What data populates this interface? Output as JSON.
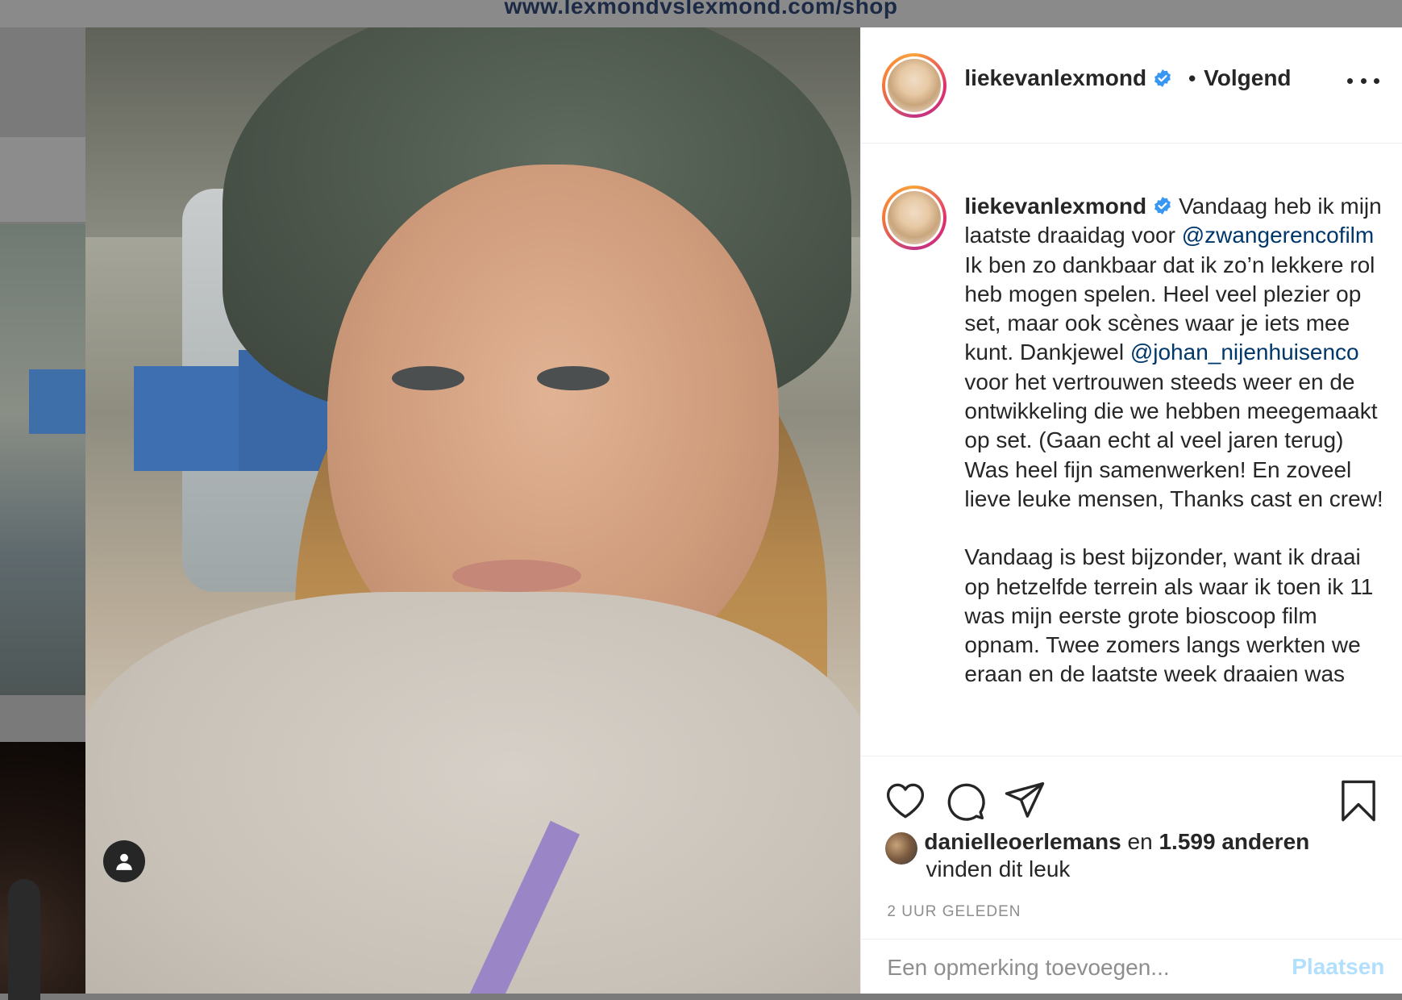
{
  "background": {
    "url_text": "www.lexmondvslexmond.com/shop"
  },
  "post": {
    "author": {
      "username": "liekevanlexmond",
      "verified": true
    },
    "header": {
      "separator": "•",
      "follow_status": "Volgend",
      "more_icon": "more-horizontal-icon"
    },
    "caption": {
      "username": "liekevanlexmond",
      "part1": "Vandaag heb ik mijn laatste draaidag voor",
      "mention1": "@zwangerencofilm",
      "part2": "Ik ben zo dankbaar dat ik zo’n lekkere rol heb mogen spelen. Heel veel plezier op set, maar ook scènes waar je iets mee kunt. Dankjewel",
      "mention2": "@johan_nijenhuisenco",
      "part3": "voor het vertrouwen steeds weer en de ontwikkeling die we hebben meegemaakt op set. (Gaan echt al veel jaren terug) Was heel fijn samenwerken! En zoveel lieve leuke mensen, Thanks cast en crew!",
      "paragraph2": "Vandaag is best bijzonder, want ik draai op hetzelfde terrein als waar ik toen ik 11 was mijn eerste grote bioscoop film opnam. Twee zomers langs werkten we eraan en de laatste week draaien was"
    },
    "actions": {
      "like_icon": "heart-icon",
      "comment_icon": "comment-icon",
      "share_icon": "share-icon",
      "save_icon": "bookmark-icon"
    },
    "likes": {
      "user": "danielleoerlemans",
      "connector": "en",
      "others": "1.599 anderen",
      "suffix": "vinden dit leuk"
    },
    "timestamp": "2 UUR GELEDEN",
    "comment": {
      "placeholder": "Een opmerking toevoegen...",
      "post_label": "Plaatsen"
    },
    "tag_icon": "user-tag-icon"
  },
  "colors": {
    "link": "#00376b",
    "verified": "#3897f0",
    "post_button_disabled": "#b2dffc",
    "muted": "#8e8e8e"
  }
}
